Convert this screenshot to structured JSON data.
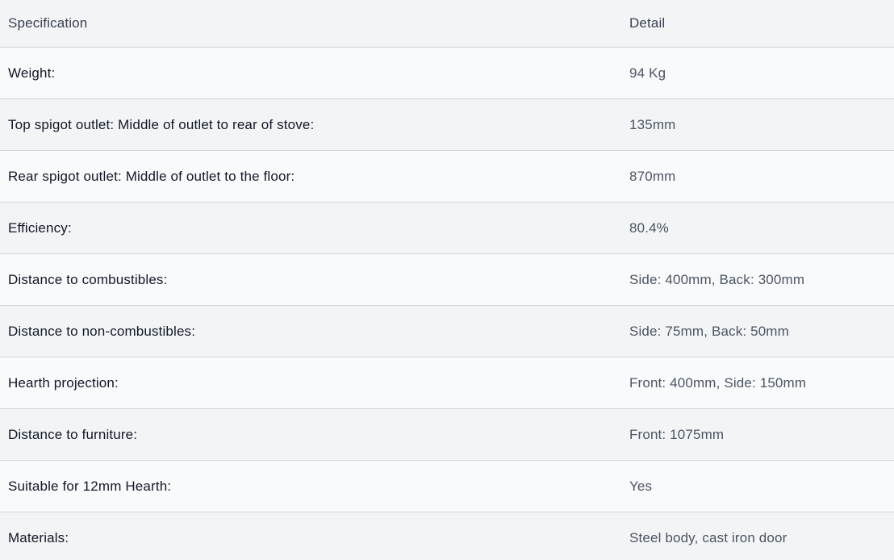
{
  "table": {
    "headers": {
      "spec": "Specification",
      "detail": "Detail"
    },
    "rows": [
      {
        "label": "Weight:",
        "value": "94 Kg"
      },
      {
        "label": "Top spigot outlet: Middle of outlet to rear of stove:",
        "value": "135mm"
      },
      {
        "label": "Rear spigot outlet: Middle of outlet to the floor:",
        "value": "870mm"
      },
      {
        "label": "Efficiency:",
        "value": "80.4%"
      },
      {
        "label": "Distance to combustibles:",
        "value": "Side: 400mm, Back: 300mm"
      },
      {
        "label": "Distance to non-combustibles:",
        "value": "Side: 75mm, Back: 50mm"
      },
      {
        "label": "Hearth projection:",
        "value": "Front: 400mm, Side: 150mm"
      },
      {
        "label": "Distance to furniture:",
        "value": "Front: 1075mm"
      },
      {
        "label": "Suitable for 12mm Hearth:",
        "value": "Yes"
      },
      {
        "label": "Materials:",
        "value": "Steel body, cast iron door"
      }
    ]
  }
}
